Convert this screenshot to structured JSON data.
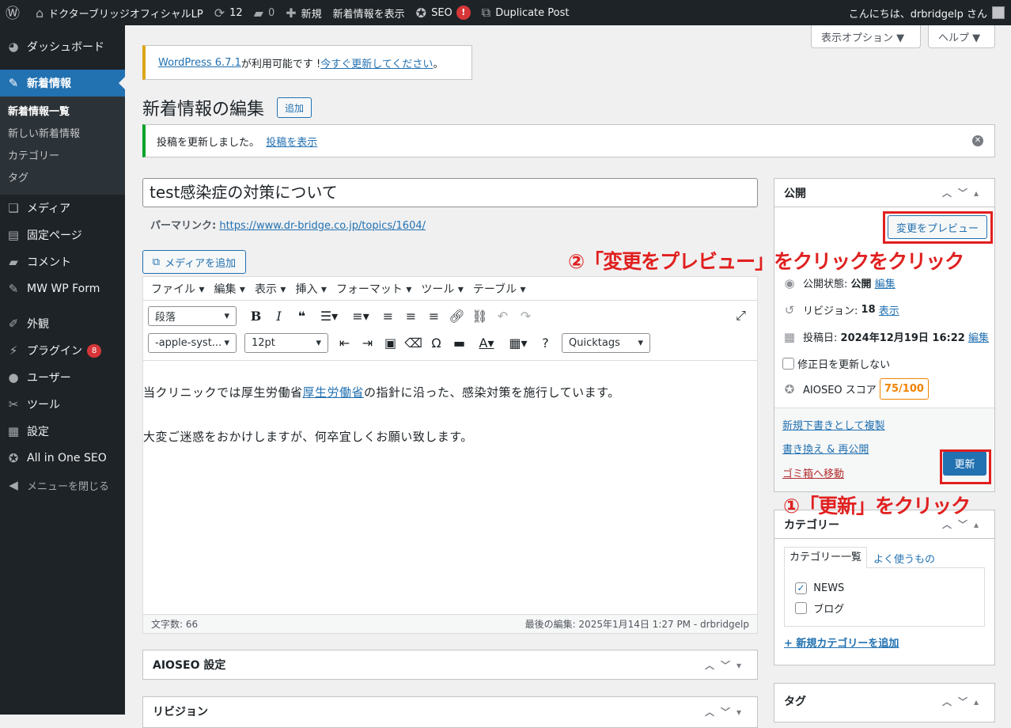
{
  "adminbar": {
    "site_name": "ドクターブリッジオフィシャルLP",
    "updates_count": "12",
    "comments_count": "0",
    "new_label": "新規",
    "view_label": "新着情報を表示",
    "seo_label": "SEO",
    "seo_badge": "!",
    "duplicate_label": "Duplicate Post",
    "greeting": "こんにちは、drbridgelp さん"
  },
  "sidebar": {
    "dashboard": "ダッシュボード",
    "news": "新着情報",
    "news_sub": [
      "新着情報一覧",
      "新しい新着情報",
      "カテゴリー",
      "タグ"
    ],
    "media": "メディア",
    "pages": "固定ページ",
    "comments": "コメント",
    "mwwpform": "MW WP Form",
    "appearance": "外観",
    "plugins": "プラグイン",
    "plugins_badge": "8",
    "users": "ユーザー",
    "tools": "ツール",
    "settings": "設定",
    "aioseo": "All in One SEO",
    "collapse": "メニューを閉じる"
  },
  "screen_options": "表示オプション ▼",
  "help": "ヘルプ ▼",
  "update_notice": {
    "link1": "WordPress 6.7.1",
    "text": " が利用可能です ! ",
    "link2": "今すぐ更新してください",
    "end": "。"
  },
  "page_title": "新着情報の編集",
  "add_button": "追加",
  "updated_notice": {
    "text": "投稿を更新しました。",
    "link": "投稿を表示"
  },
  "post_title": "test感染症の対策について",
  "permalink": {
    "label": "パーマリンク:",
    "url": "https://www.dr-bridge.co.jp/topics/1604/"
  },
  "add_media": "メディアを追加",
  "editor": {
    "menu": [
      "ファイル ▾",
      "編集 ▾",
      "表示 ▾",
      "挿入 ▾",
      "フォーマット ▾",
      "ツール ▾",
      "テーブル ▾"
    ],
    "format_select": "段落",
    "font_select": "-apple-syst...",
    "size_select": "12pt",
    "quicktags": "Quicktags",
    "para1_before": "当クリニックでは厚生労働省",
    "para1_link": "厚生労働省",
    "para1_after": "の指針に沿った、感染対策を施行しています。",
    "para2": "大変ご迷惑をおかけしますが、何卒宜しくお願い致します。",
    "word_count": "文字数: 66",
    "last_edit": "最後の編集: 2025年1月14日 1:27 PM - drbridgelp"
  },
  "aioseo_box": "AIOSEO 設定",
  "revision_box": "リビジョン",
  "publish": {
    "title": "公開",
    "preview": "変更をプレビュー",
    "status_label": "公開状態:",
    "status_value": "公開",
    "status_edit": "編集",
    "revision_label": "リビジョン:",
    "revision_value": "18",
    "revision_link": "表示",
    "date_label": "投稿日:",
    "date_value": "2024年12月19日 16:22",
    "date_edit": "編集",
    "no_modify": "修正日を更新しない",
    "aioseo_label": "AIOSEO スコア",
    "aioseo_score": "75/100",
    "new_draft": "新規下書きとして複製",
    "rewrite": "書き換え & 再公開",
    "trash": "ゴミ箱へ移動",
    "update": "更新"
  },
  "category": {
    "title": "カテゴリー",
    "tab_all": "カテゴリー一覧",
    "tab_popular": "よく使うもの",
    "items": [
      "NEWS",
      "ブログ"
    ],
    "add_new": "+ 新規カテゴリーを追加"
  },
  "tag_box": "タグ",
  "annotations": {
    "a1": "①「更新」をクリック",
    "a2": "②「変更をプレビュー」をクリックをクリック"
  },
  "colors": {
    "accent": "#2271b1",
    "annotation_red": "#e0201f",
    "sidebar_bg": "#1d2327"
  }
}
